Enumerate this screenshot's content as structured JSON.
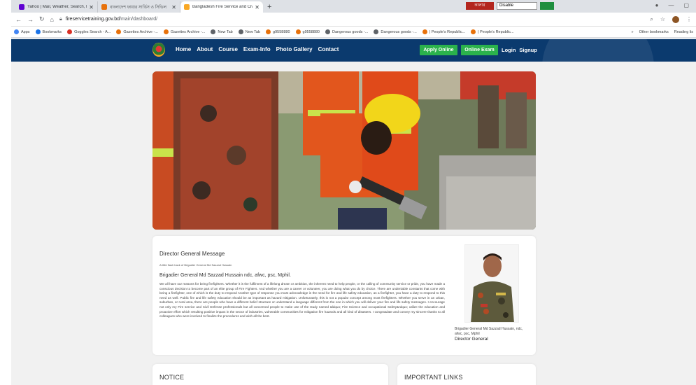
{
  "browser": {
    "tabs": [
      {
        "title": "Yahoo | Mail, Weather, Search, P...",
        "color": "#6001d2",
        "active": false
      },
      {
        "title": "বাংলাদেশ ফায়ার সার্ভিস ও সিভিল",
        "color": "#e8710a",
        "active": false
      },
      {
        "title": "Bangladesh Fire Service and Civil",
        "color": "#f9a825",
        "active": true
      }
    ],
    "new_tab": "+",
    "extension_red_label": "কালার",
    "extension_select": "Disable",
    "url_host": "fireservicetraining.gov.bd",
    "url_path": "/main/dashboard/",
    "bookmarks": [
      {
        "label": "Apps",
        "color": "#4285f4"
      },
      {
        "label": "Bookmarks",
        "color": "#1a73e8"
      },
      {
        "label": "Goggles Search - A...",
        "color": "#d93025"
      },
      {
        "label": "Gazettes Archive -...",
        "color": "#e8710a"
      },
      {
        "label": "Gazettes Archive -...",
        "color": "#e8710a"
      },
      {
        "label": "New Tab",
        "color": "#5f6368"
      },
      {
        "label": "New Tab",
        "color": "#5f6368"
      },
      {
        "label": "g9558880",
        "color": "#e8710a"
      },
      {
        "label": "g9558880",
        "color": "#e8710a"
      },
      {
        "label": "Dangerous goods -...",
        "color": "#5f6368"
      },
      {
        "label": "Dangerous goods -...",
        "color": "#5f6368"
      },
      {
        "label": "| People's Republic...",
        "color": "#e8710a"
      },
      {
        "label": "| People's Republic...",
        "color": "#e8710a"
      }
    ],
    "other_bookmarks": "Other bookmarks",
    "reading_list": "Reading lis"
  },
  "site": {
    "menu": [
      "Home",
      "About",
      "Course",
      "Exam-Info",
      "Photo Gallery",
      "Contact"
    ],
    "apply_label": "Apply Online",
    "exam_label": "Online Exam",
    "login_label": "Login",
    "signup_label": "Signup",
    "nav_color": "#0b3a6e",
    "accent_green": "#2bb24c"
  },
  "dg_message": {
    "heading": "Director General Message",
    "subheading": "A little flash back of Brigadier General Md Sazzad Hussain",
    "name_line": "Brigadier General Md Sazzad Hussain ndc, afwc, psc, Mphil.",
    "body": "We all have our reasons for being firefighters. Whether it is the fulfilment of a lifelong dream or ambition, the inherent need to help people, or the calling of community service or pride, you have made a conscious decision to become part of an elite group of Fire Fighters. And whether you are a career or volunteer, you are doing what you do by choice. There are undeniable constants that come with being a firefighter, one of which is the duty to respond Another type of response you must acknowledge is the need for fire and life safety education, as a firefighter, you have a duty to respond to this need as well. Public fire and life safety education should be as important as hazard mitigation. Unfortunately, this is not a popular concept among most firefighters. Whether you serve in an urban, suburban, or rural area, there are people who have a different belief structure or understand a language different from the one in which you will deliver your fire and life safety messages. I encourage not only my Fire service and Civil Defense professionals but all concerned people to make use of the study named &ldquo; Fire Science and occupational Safety&rdquo; utilize the education and proactive effort which resulting positive impact in the sector of industries, vulnerable communities for mitigation fire hazards and all kind of disasters. I congratulate and convey my sincere thanks to all colleagues who were involved to finalize the procedures and wish all the best.",
    "caption": "Brigadier General Md Sazzad Hussain, ndc, afwc, psc, Mphil",
    "role": "Director General"
  },
  "notice": {
    "title": "NOTICE"
  },
  "important_links": {
    "title": "IMPORTANT LINKS"
  }
}
